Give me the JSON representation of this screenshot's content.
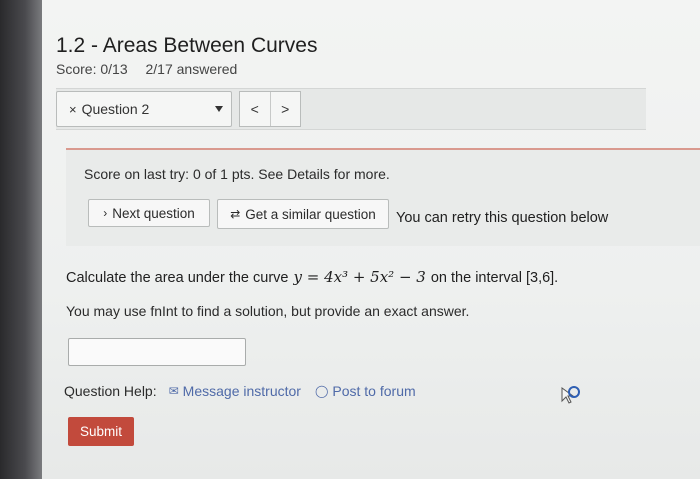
{
  "header": {
    "title": "1.2 - Areas Between Curves",
    "score": "Score: 0/13",
    "answered": "2/17 answered"
  },
  "question_nav": {
    "close_glyph": "×",
    "current_question": "Question 2",
    "prev": "<",
    "next": ">"
  },
  "status": {
    "last_try_prefix": "Score on last try: ",
    "last_try_score": "0 of 1 pts",
    "last_try_suffix": ". See Details for more."
  },
  "actions": {
    "next_question_label": "Next question",
    "next_question_icon": "chevron-right-icon",
    "similar_label": "Get a similar question",
    "similar_icon": "refresh-icon",
    "retry_message": "You can retry this question below"
  },
  "problem": {
    "prefix": "Calculate the area under the curve",
    "equation": "y = 4x³ + 5x² − 3",
    "suffix": "on the interval [3,6].",
    "hint": "You may use fnInt to find a solution, but provide an exact answer."
  },
  "answer": {
    "value": ""
  },
  "help": {
    "label": "Question Help:",
    "message_label": "Message instructor",
    "message_icon": "envelope-icon",
    "forum_label": "Post to forum",
    "forum_icon": "speech-bubble-icon"
  },
  "submit_label": "Submit",
  "colors": {
    "submit": "#c24a3c",
    "link": "#4f6aa8",
    "divider": "#d99a8f"
  }
}
